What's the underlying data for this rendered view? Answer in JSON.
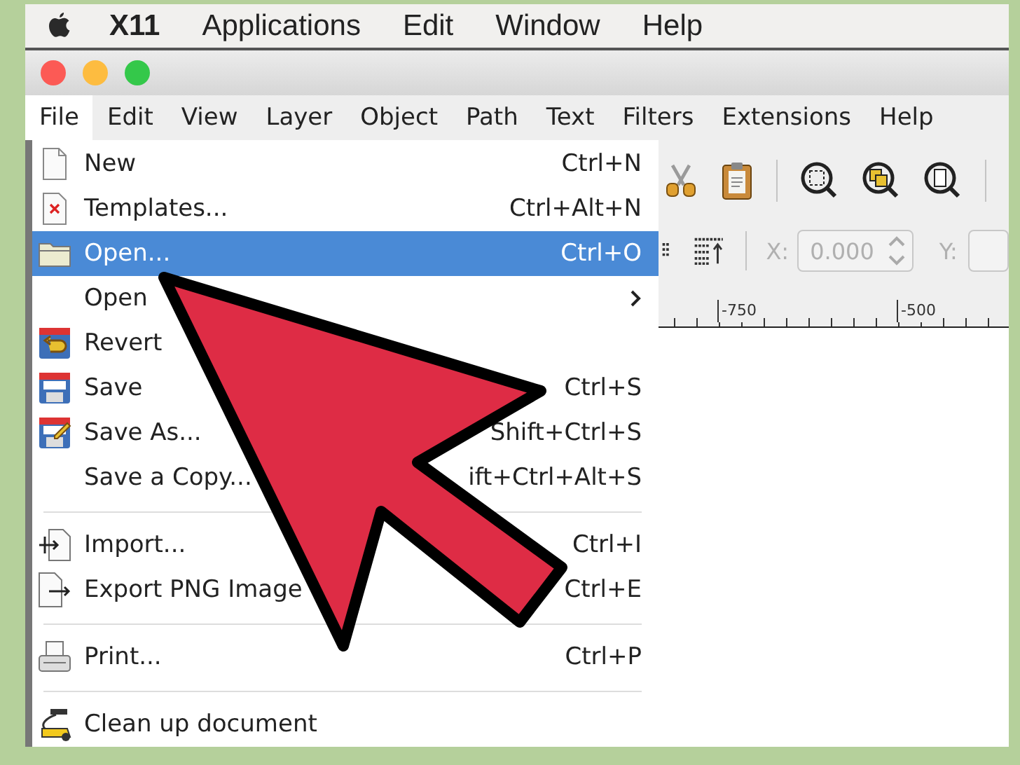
{
  "system_menubar": {
    "items": [
      "X11",
      "Applications",
      "Edit",
      "Window",
      "Help"
    ]
  },
  "window": {
    "menubar": [
      {
        "label": "File",
        "selected": true
      },
      {
        "label": "Edit",
        "selected": false
      },
      {
        "label": "View",
        "selected": false
      },
      {
        "label": "Layer",
        "selected": false
      },
      {
        "label": "Object",
        "selected": false
      },
      {
        "label": "Path",
        "selected": false
      },
      {
        "label": "Text",
        "selected": false
      },
      {
        "label": "Filters",
        "selected": false
      },
      {
        "label": "Extensions",
        "selected": false
      },
      {
        "label": "Help",
        "selected": false
      }
    ]
  },
  "file_menu": {
    "items": [
      {
        "kind": "item",
        "label": "New",
        "shortcut": "Ctrl+N",
        "selected": false
      },
      {
        "kind": "item",
        "label": "Templates...",
        "shortcut": "Ctrl+Alt+N",
        "selected": false
      },
      {
        "kind": "item",
        "label": "Open...",
        "shortcut": "Ctrl+O",
        "selected": true
      },
      {
        "kind": "submenu",
        "label": "Open",
        "selected": false
      },
      {
        "kind": "item",
        "label": "Revert",
        "selected": false
      },
      {
        "kind": "item",
        "label": "Save",
        "shortcut": "Ctrl+S",
        "selected": false
      },
      {
        "kind": "item",
        "label": "Save As...",
        "shortcut": "Shift+Ctrl+S",
        "selected": false
      },
      {
        "kind": "item",
        "label": "Save a Copy...",
        "shortcut": "ift+Ctrl+Alt+S",
        "selected": false
      },
      {
        "kind": "separator"
      },
      {
        "kind": "item",
        "label": "Import...",
        "shortcut": "Ctrl+I",
        "selected": false
      },
      {
        "kind": "item",
        "label": "Export PNG Image",
        "shortcut": "Ctrl+E",
        "selected": false
      },
      {
        "kind": "separator"
      },
      {
        "kind": "item",
        "label": "Print...",
        "shortcut": "Ctrl+P",
        "selected": false
      },
      {
        "kind": "separator"
      },
      {
        "kind": "item",
        "label": "Clean up document",
        "selected": false
      }
    ]
  },
  "toolbar": {
    "x_label": "X:",
    "x_field": {
      "value": "0.000",
      "disabled": true
    },
    "y_label": "Y:"
  },
  "ruler": {
    "labels": [
      "-750",
      "-500"
    ]
  }
}
